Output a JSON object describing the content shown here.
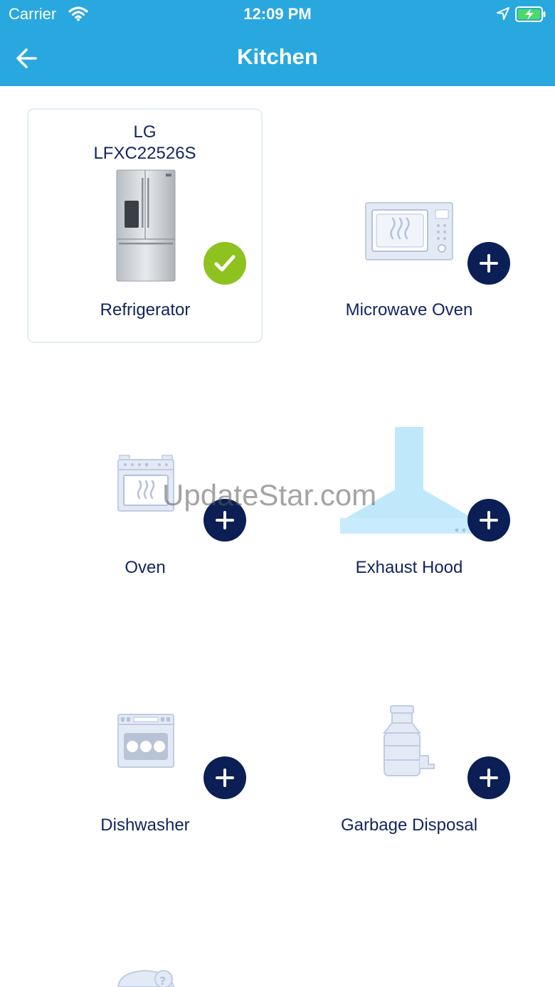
{
  "status_bar": {
    "carrier": "Carrier",
    "time": "12:09 PM"
  },
  "nav": {
    "title": "Kitchen"
  },
  "selected": {
    "brand": "LG",
    "model": "LFXC22526S"
  },
  "appliances": [
    {
      "label": "Refrigerator",
      "added": true
    },
    {
      "label": "Microwave Oven",
      "added": false
    },
    {
      "label": "Oven",
      "added": false
    },
    {
      "label": "Exhaust Hood",
      "added": false
    },
    {
      "label": "Dishwasher",
      "added": false
    },
    {
      "label": "Garbage Disposal",
      "added": false
    }
  ],
  "watermark": "UpdateStar.com",
  "colors": {
    "header": "#29a8e0",
    "navy": "#0b1f56",
    "check": "#8dc21f",
    "text": "#11245e"
  },
  "icons": [
    "wifi-icon",
    "location-arrow-icon",
    "battery-charging-icon",
    "back-arrow-icon",
    "check-icon",
    "plus-icon"
  ]
}
